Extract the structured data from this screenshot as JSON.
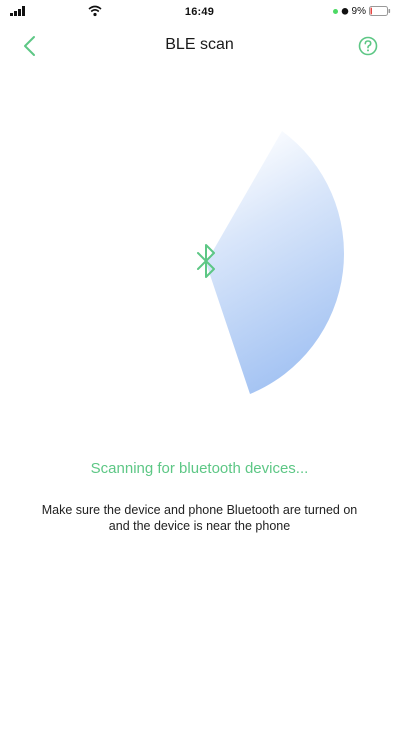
{
  "status_bar": {
    "time": "16:49",
    "battery_percent": "9%",
    "battery_level": 0.09,
    "icons": [
      "signal-icon",
      "wifi-icon",
      "green-dot-icon",
      "alarm-icon",
      "battery-icon"
    ]
  },
  "nav": {
    "title": "BLE scan",
    "back_icon": "chevron-left-icon",
    "help_icon": "question-circle-icon"
  },
  "radar": {
    "center_icon": "bluetooth-icon"
  },
  "scan": {
    "status": "Scanning for bluetooth devices...",
    "hint": "Make sure the device and phone Bluetooth are turned on and the device is near the phone"
  },
  "colors": {
    "accent": "#5dc785",
    "radar_blue": "#9fc0f2",
    "text": "#1a1a1a"
  }
}
